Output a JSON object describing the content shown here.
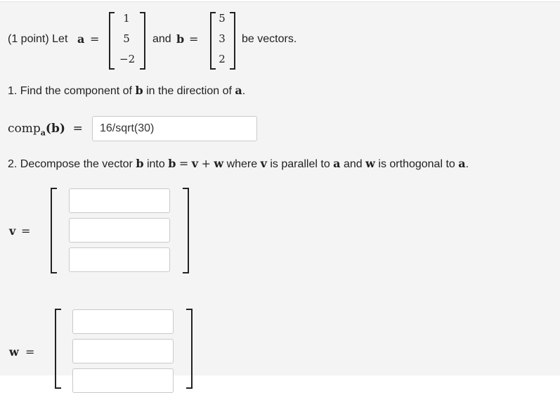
{
  "problem": {
    "intro": "(1 point) Let",
    "a_symbol": "a",
    "a_values": [
      "1",
      "5",
      "−2"
    ],
    "and_text": "and",
    "b_symbol": "b",
    "b_values": [
      "5",
      "3",
      "2"
    ],
    "be_vectors": "be vectors."
  },
  "part1": {
    "prefix": "1. Find the component of",
    "b": "b",
    "middle": "in the direction of",
    "a": "a",
    "suffix": ".",
    "comp_label": "comp",
    "comp_sub": "a",
    "comp_arg": "(b)",
    "answer": "16/sqrt(30)"
  },
  "part2": {
    "prefix": "2. Decompose the vector",
    "b": "b",
    "into": "into",
    "eq_lhs": "b",
    "eq": "=",
    "v": "v",
    "plus": "+",
    "w": "w",
    "where": "where",
    "v2": "v",
    "parallel": "is parallel to",
    "a": "a",
    "and": "and",
    "w2": "w",
    "orthogonal": "is orthogonal to",
    "a2": "a",
    "end": ".",
    "v_label": "v",
    "w_label": "w",
    "eq_sign": "=",
    "v_inputs": [
      "",
      "",
      ""
    ],
    "w_inputs": [
      "",
      "",
      ""
    ]
  }
}
